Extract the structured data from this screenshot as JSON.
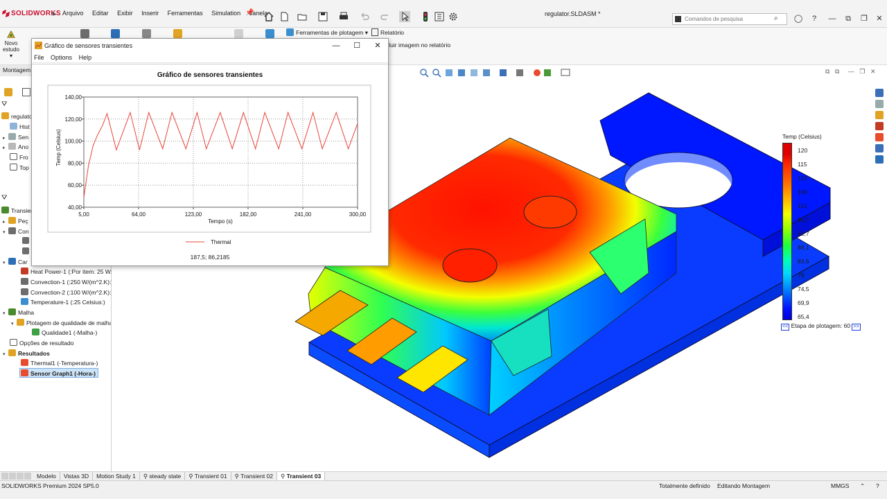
{
  "app": {
    "brand": "SOLIDWORKS",
    "menus": [
      "Arquivo",
      "Editar",
      "Exibir",
      "Inserir",
      "Ferramentas",
      "Simulation",
      "Janela"
    ],
    "document_title": "regulator.SLDASM *",
    "search_placeholder": "Comandos de pesquisa"
  },
  "ribbon": {
    "new_study_line1": "Novo",
    "new_study_line2": "estudo",
    "plot_tools": "Ferramentas de plotagem",
    "report": "Relatório",
    "include_image": "cluir imagem no relatório"
  },
  "left_panel": {
    "tab": "Montagem",
    "items": [
      {
        "label": "regulator",
        "icon": "assembly-icon"
      },
      {
        "label": "Hist",
        "icon": "history-icon"
      },
      {
        "label": "Sen",
        "icon": "sensors-icon"
      },
      {
        "label": "Ano",
        "icon": "annotations-icon"
      },
      {
        "label": "Fro",
        "icon": "plane-icon"
      },
      {
        "label": "Top",
        "icon": "plane-icon"
      },
      {
        "label": "Transient",
        "icon": "study-icon"
      },
      {
        "label": "Peç",
        "icon": "parts-icon"
      },
      {
        "label": "Con",
        "icon": "connections-icon"
      },
      {
        "label": "Car",
        "icon": "loads-icon"
      },
      {
        "label": "Heat Power-1 (:Por item: 25 W:)",
        "icon": "heat-power-icon"
      },
      {
        "label": "Convection-1 (:250 W/(m^2.K):)",
        "icon": "convection-icon"
      },
      {
        "label": "Convection-2 (:100 W/(m^2.K):)",
        "icon": "convection-icon"
      },
      {
        "label": "Temperature-1 (:25 Celsius:)",
        "icon": "temperature-icon"
      },
      {
        "label": "Malha",
        "icon": "mesh-icon"
      },
      {
        "label": "Plotagem de qualidade de malha",
        "icon": "mesh-quality-icon"
      },
      {
        "label": "Qualidade1 (-Malha-)",
        "icon": "quality-plot-icon"
      },
      {
        "label": "Opções de resultado",
        "icon": "result-options-icon"
      },
      {
        "label": "Resultados",
        "icon": "results-folder-icon"
      },
      {
        "label": "Thermal1 (-Temperatura-)",
        "icon": "thermal-plot-icon"
      },
      {
        "label": "Sensor Graph1 (-Hora-)",
        "icon": "sensor-graph-icon"
      }
    ]
  },
  "dialog": {
    "title": "Gráfico de sensores transientes",
    "menu": [
      "File",
      "Options",
      "Help"
    ],
    "readout": "187,5; 86,2185"
  },
  "chart_data": {
    "type": "line",
    "title": "Gráfico de sensores transientes",
    "xlabel": "Tempo (s)",
    "ylabel": "Temp (Celsius)",
    "xlim": [
      5,
      300
    ],
    "ylim": [
      40,
      140
    ],
    "x_ticks": [
      "5,00",
      "64,00",
      "123,00",
      "182,00",
      "241,00",
      "300,00"
    ],
    "y_ticks": [
      "40,00",
      "60,00",
      "80,00",
      "100,00",
      "120,00",
      "140,00"
    ],
    "grid": true,
    "legend_position": "bottom",
    "series": [
      {
        "name": "Thermal",
        "color": "#e8443a",
        "x": [
          5,
          10,
          15,
          20,
          25,
          30,
          40,
          55,
          65,
          75,
          90,
          100,
          115,
          127,
          137,
          152,
          165,
          177,
          190,
          200,
          215,
          225,
          240,
          252,
          262,
          277,
          290,
          300
        ],
        "y": [
          49,
          78,
          96,
          106,
          114,
          125,
          92,
          126,
          92,
          126,
          93,
          126,
          93,
          126,
          93,
          126,
          93,
          126,
          93,
          126,
          93,
          126,
          93,
          126,
          93,
          126,
          93,
          116
        ]
      }
    ]
  },
  "legend": {
    "title": "Temp (Celsius)",
    "values": [
      "120",
      "115",
      "110",
      "106",
      "101",
      "96,7",
      "92,7",
      "88,1",
      "83,6",
      "79",
      "74,5",
      "69,9",
      "65,4"
    ],
    "step_label": "Etapa de plotagem: 60",
    "prev": "<<",
    "next": ">>"
  },
  "tabs": [
    "Modelo",
    "Vistas 3D",
    "Motion Study 1",
    "steady state",
    "Transient 01",
    "Transient 02",
    "Transient 03"
  ],
  "status": {
    "version": "SOLIDWORKS Premium 2024 SP5.0",
    "defined": "Totalmente definido",
    "editing": "Editando Montagem",
    "units": "MMGS"
  }
}
